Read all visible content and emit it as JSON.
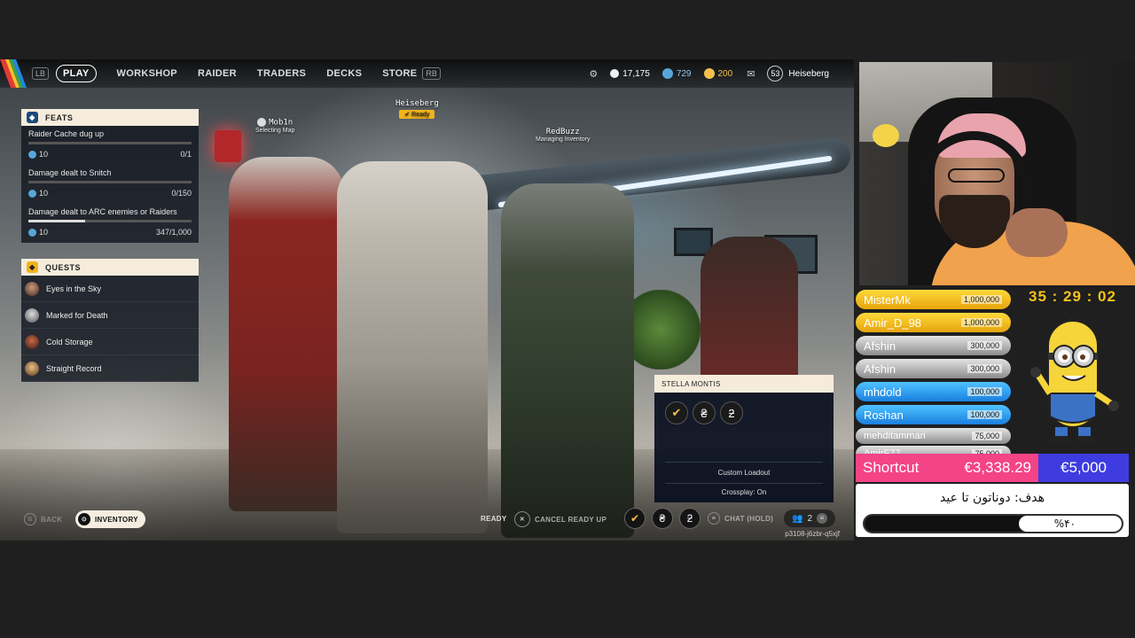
{
  "nav": {
    "lb_key": "LB",
    "rb_key": "RB",
    "items": [
      {
        "label": "PLAY",
        "active": true
      },
      {
        "label": "WORKSHOP"
      },
      {
        "label": "RAIDER"
      },
      {
        "label": "TRADERS"
      },
      {
        "label": "DECKS"
      },
      {
        "label": "STORE"
      }
    ],
    "currencies": [
      {
        "value": "17,175",
        "icon": "coins-icon",
        "color": "#ffffff"
      },
      {
        "value": "729",
        "icon": "blue-token-icon",
        "color": "#58a6d8"
      },
      {
        "value": "200",
        "icon": "gold-token-icon",
        "color": "#f3c14b"
      }
    ],
    "player_level": "53",
    "player_name": "Heiseberg"
  },
  "feats": {
    "header": "FEATS",
    "items": [
      {
        "title": "Raider Cache dug up",
        "reward": "10",
        "progress": "0/1",
        "fraction": 0.0
      },
      {
        "title": "Damage dealt to Snitch",
        "reward": "10",
        "progress": "0/150",
        "fraction": 0.0
      },
      {
        "title": "Damage dealt to ARC enemies or Raiders",
        "reward": "10",
        "progress": "347/1,000",
        "fraction": 0.347
      }
    ]
  },
  "quests": {
    "header": "QUESTS",
    "items": [
      {
        "label": "Eyes in the Sky"
      },
      {
        "label": "Marked for Death"
      },
      {
        "label": "Cold Storage"
      },
      {
        "label": "Straight Record"
      }
    ]
  },
  "party": {
    "mob1n": {
      "name": "Mob1n",
      "status": "Selecting Map"
    },
    "heiseberg": {
      "name": "Heiseberg",
      "status": "Ready"
    },
    "redbuzz": {
      "name": "RedBuzz",
      "status": "Managing Inventory"
    }
  },
  "loadout": {
    "title": "STELLA MONTIS",
    "custom": "Custom Loadout",
    "crossplay": "Crossplay: On"
  },
  "bottom": {
    "back": "BACK",
    "back_key": "B",
    "inventory": "INVENTORY",
    "ready": "READY",
    "cancel_ready": "CANCEL READY UP",
    "chat": "CHAT (HOLD)",
    "party_count": "2",
    "session_code": "p3108-j6zbr-q5xjf"
  },
  "stream": {
    "timer": "35 : 29 : 02",
    "donors": [
      {
        "name": "MisterMk",
        "amount": "1,000,000",
        "tier": "gold"
      },
      {
        "name": "Amir_D_98",
        "amount": "1,000,000",
        "tier": "gold"
      },
      {
        "name": "Afshin",
        "amount": "300,000",
        "tier": "silver"
      },
      {
        "name": "Afshin",
        "amount": "300,000",
        "tier": "silver"
      },
      {
        "name": "mhdold",
        "amount": "100,000",
        "tier": "blue"
      },
      {
        "name": "Roshan",
        "amount": "100,000",
        "tier": "blue"
      },
      {
        "name": "mehditammari",
        "amount": "75,000",
        "tier": "silver"
      },
      {
        "name": "AmirF77",
        "amount": "75,000",
        "tier": "silver"
      }
    ],
    "shortcut_title": "Shortcut",
    "raised": "€3,338.29",
    "goal": "€5,000",
    "goal_title": "هدف: دوناتون تا عید",
    "goal_percent_label": "%۴۰",
    "goal_fraction": 0.4,
    "colors": {
      "pink": "#f44387",
      "purple": "#3e3ce0",
      "gold": "#f7c21b"
    }
  }
}
